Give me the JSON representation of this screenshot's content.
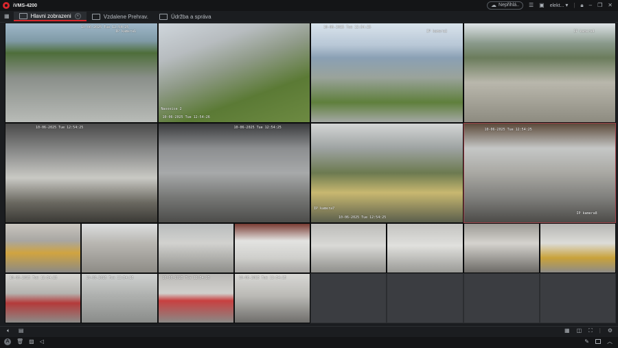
{
  "app": {
    "title": "iVMS-4200",
    "logo_icon": "hikvision-logo-icon"
  },
  "titlebar": {
    "cloud_status": "Nepřihlá..",
    "user": "elekt..."
  },
  "tabs": [
    {
      "label": "Hlavni zobrazeni",
      "active": true,
      "closable": true
    },
    {
      "label": "Vzdalene Prehrav.",
      "active": false
    },
    {
      "label": "Údržba a správa",
      "active": false
    }
  ],
  "cameras": [
    {
      "ts": "10-06-2025 Tue 12:54:25",
      "name": "IP kamera1",
      "bg": "linear-gradient(180deg,#9fb7c9 0%,#7f9aa6 18%,#4e6e3a 30%,#8a8f8a 55%,#b8bbb7 100%)"
    },
    {
      "ts": "",
      "name": "Nasovice 2",
      "ts2": "10-06-2025 Tue 12:54:26",
      "bg": "linear-gradient(160deg,#cfd6dc 0%,#b7bcbf 25%,#8f9a88 45%,#5b7a35 70%,#6d8a42 100%)"
    },
    {
      "ts": "10-06-2025 Tue 12:54:25",
      "name": "IP kamera2",
      "bg": "linear-gradient(180deg,#d9e3ec 0%,#b8c7d6 22%,#8aa0b4 35%,#9aa39b 55%,#5f7f3c 80%,#a4a8a4 100%)"
    },
    {
      "ts": "",
      "name": "IP kamera4",
      "bg": "linear-gradient(180deg,#dfe4e8 0%,#8a9a8c 20%,#6b7c5c 35%,#b9b7ac 60%,#8d8b80 100%)"
    },
    {
      "ts": "10-06-2025 Tue 12:54:25",
      "name": "",
      "bg": "linear-gradient(180deg,#4a4a4a 0%,#8e8f8e 30%,#c9c9c4 55%,#6a6860 80%,#3b3a36 100%)"
    },
    {
      "ts": "10-06-2025 Tue 12:54:25",
      "name": "",
      "bg": "linear-gradient(180deg,#3a3b3d 0%,#8c8e90 25%,#a7a9aa 50%,#767775 75%,#4c4c4a 100%)"
    },
    {
      "ts": "10-06-2025 Tue 12:54:25",
      "name": "IP kamera7",
      "bg": "linear-gradient(180deg,#d4d6d6 0%,#9ea3a2 25%,#6c7a50 50%,#c8b870 70%,#5a5e4c 100%)"
    },
    {
      "ts": "10-06-2025 Tue 12:54:25",
      "name": "IP kamera8",
      "bg": "linear-gradient(180deg,#5c4a3a 0%,#c5c7c6 25%,#a9a8a3 50%,#7f7f7c 75%,#4c4b48 100%)"
    },
    {
      "bg": "linear-gradient(180deg,#c9c6bf 0%,#a8a6a2 35%,#d0a440 60%,#8b8a86 100%)"
    },
    {
      "bg": "linear-gradient(180deg,#dcdedf 0%,#b8b6b1 40%,#8e8c86 100%)"
    },
    {
      "bg": "linear-gradient(180deg,#b9bcbd 0%,#d2d2cf 40%,#8e8e8a 100%)"
    },
    {
      "bg": "linear-gradient(180deg,#7a3c34 0%,#e3e3e1 35%,#cfcfcc 70%,#a7a6a3 100%)"
    },
    {
      "bg": "linear-gradient(180deg,#bcbcb9 0%,#d9d9d6 45%,#8f8f8b 100%)"
    },
    {
      "bg": "linear-gradient(180deg,#c3c3c0 0%,#e0e0dd 45%,#9a9a96 100%)"
    },
    {
      "bg": "linear-gradient(180deg,#9c9a95 0%,#d5d3ce 40%,#6c6a66 100%)"
    },
    {
      "bg": "linear-gradient(180deg,#b6b6b3 0%,#dcdcd8 40%,#c9a23a 70%,#8d8c88 100%)"
    },
    {
      "ts": "10-06-2025 Tue 12:54:25",
      "bg": "linear-gradient(180deg,#d6d6d3 0%,#b5b4b0 40%,#b43a3a 60%,#8c8b88 100%)"
    },
    {
      "ts": "10-06-2025 Tue 12:54:25",
      "bg": "linear-gradient(180deg,#cfd1d0 0%,#aeb0ae 45%,#8a8c8a 100%)"
    },
    {
      "ts": "10-06-2025 Tue 12:54:25",
      "bg": "linear-gradient(180deg,#b9b8b5 0%,#d1d0cd 40%,#c84040 55%,#8a8986 100%)"
    },
    {
      "ts": "10-06-2025 Tue 12:54:25",
      "bg": "linear-gradient(180deg,#d8d8d5 0%,#bbbab6 45%,#6f6e6b 100%)"
    }
  ],
  "empty_slots": 4,
  "bottom_toolbar": {
    "left": [
      "volume-icon",
      "record-icon"
    ],
    "right": [
      "layout-grid-icon",
      "window-mode-icon",
      "fullscreen-icon",
      "settings-icon"
    ]
  },
  "statusbar": {
    "avatar_letter": "A",
    "left": [
      "trash-icon",
      "image-icon",
      "audio-icon"
    ],
    "right": [
      "pin-icon",
      "window-icon",
      "collapse-icon"
    ]
  },
  "colors": {
    "accent": "#d8262c",
    "background": "#1b1d20",
    "selected_border": "#a3434b"
  }
}
